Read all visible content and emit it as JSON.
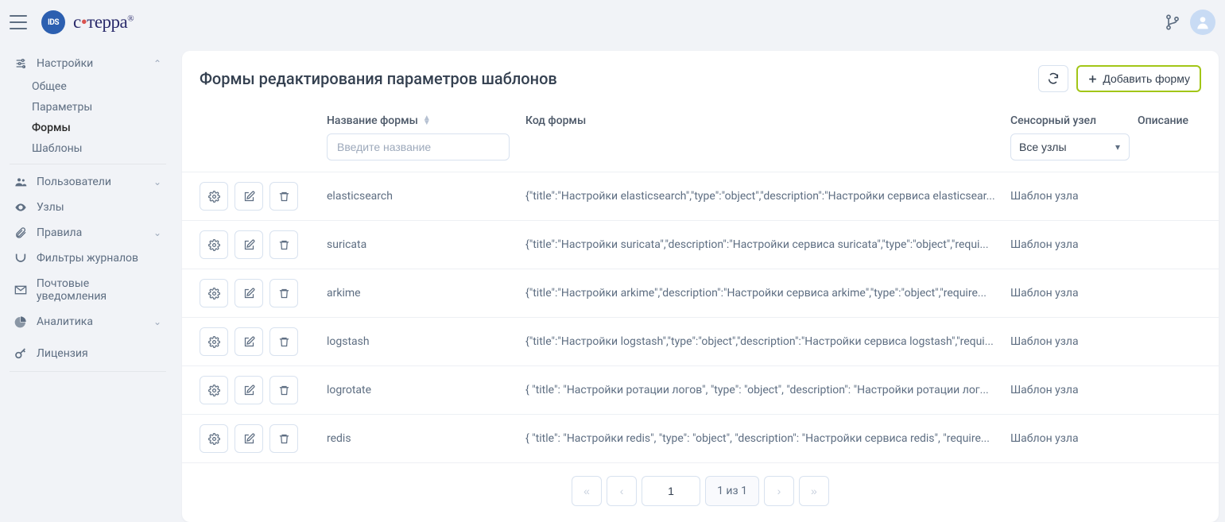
{
  "logo": {
    "badge": "IDS",
    "text_pre": "с",
    "text_dot": "•",
    "text_post": "терра",
    "reg": "®"
  },
  "sidebar": {
    "settings": {
      "label": "Настройки",
      "children": {
        "general": "Общее",
        "params": "Параметры",
        "forms": "Формы",
        "templates": "Шаблоны"
      }
    },
    "users": "Пользователи",
    "nodes": "Узлы",
    "rules": "Правила",
    "filters": "Фильтры журналов",
    "mail": "Почтовые уведомления",
    "analytics": "Аналитика",
    "license": "Лицензия"
  },
  "page": {
    "title": "Формы редактирования параметров шаблонов",
    "add_button": "Добавить форму"
  },
  "columns": {
    "name": "Название формы",
    "code": "Код формы",
    "node": "Сенсорный узел",
    "desc": "Описание"
  },
  "filters": {
    "name_placeholder": "Введите название",
    "node_selected": "Все узлы"
  },
  "rows": [
    {
      "name": "elasticsearch",
      "code": "{\"title\":\"Настройки elasticsearch\",\"type\":\"object\",\"description\":\"Настройки сервиса elasticsear...",
      "node": "Шаблон узла"
    },
    {
      "name": "suricata",
      "code": "{\"title\":\"Настройки suricata\",\"description\":\"Настройки сервиса suricata\",\"type\":\"object\",\"requi...",
      "node": "Шаблон узла"
    },
    {
      "name": "arkime",
      "code": "{\"title\":\"Настройки arkime\",\"description\":\"Настройки сервиса arkime\",\"type\":\"object\",\"require...",
      "node": "Шаблон узла"
    },
    {
      "name": "logstash",
      "code": "{\"title\":\"Настройки logstash\",\"type\":\"object\",\"description\":\"Настройки сервиса logstash\",\"requi...",
      "node": "Шаблон узла"
    },
    {
      "name": "logrotate",
      "code": "{ \"title\": \"Настройки ротации логов\", \"type\": \"object\", \"description\": \"Настройки ротации лог...",
      "node": "Шаблон узла"
    },
    {
      "name": "redis",
      "code": "{ \"title\": \"Настройки redis\", \"type\": \"object\", \"description\": \"Настройки сервиса redis\", \"require...",
      "node": "Шаблон узла"
    }
  ],
  "pagination": {
    "current": "1",
    "info": "1 из 1"
  }
}
